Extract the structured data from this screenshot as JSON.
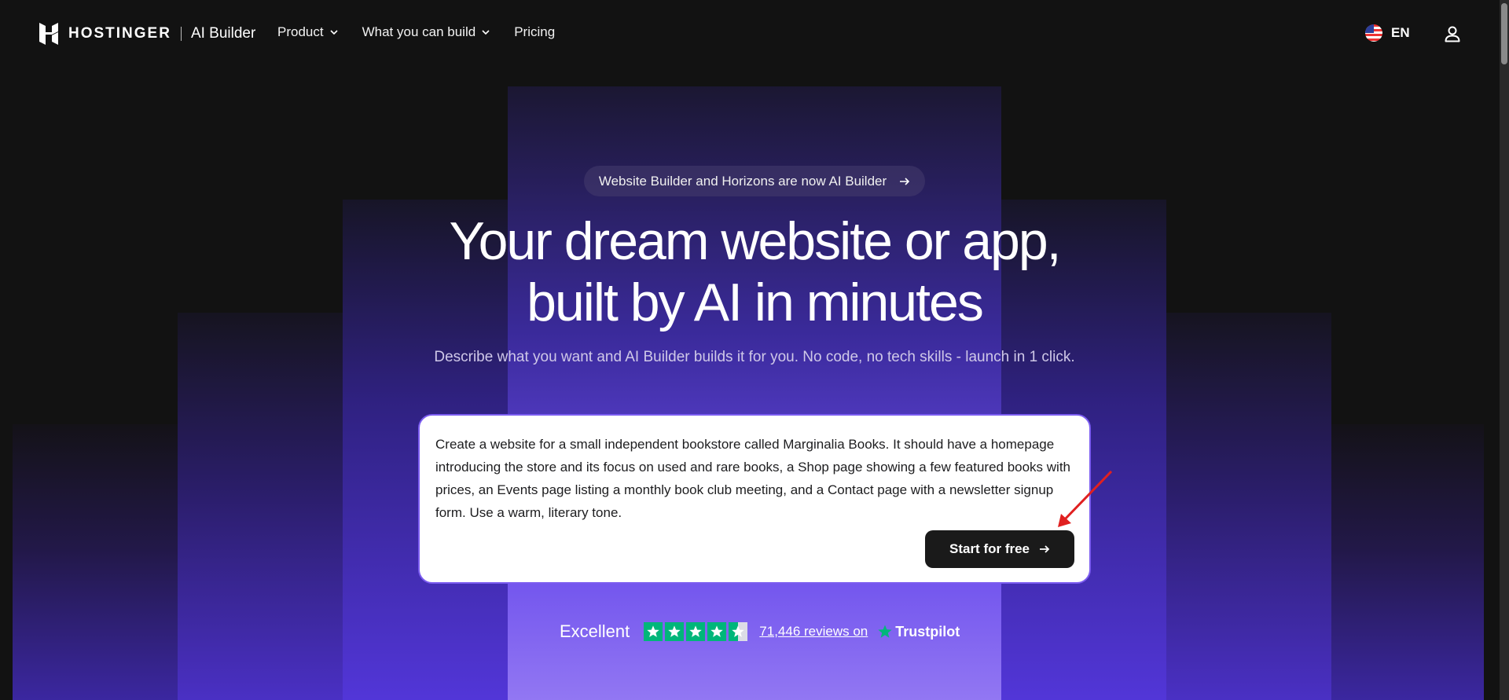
{
  "header": {
    "logo_word": "HOSTINGER",
    "logo_product": "AI Builder",
    "nav": [
      {
        "label": "Product",
        "has_dropdown": true
      },
      {
        "label": "What you can build",
        "has_dropdown": true
      },
      {
        "label": "Pricing",
        "has_dropdown": false
      }
    ],
    "language": "EN",
    "icons": {
      "flag": "us-flag-icon",
      "user": "user-icon"
    }
  },
  "hero": {
    "badge_text": "Website Builder and Horizons are now AI Builder",
    "headline_line1": "Your dream website or app,",
    "headline_line2": "built by AI in minutes",
    "subline": "Describe what you want and AI Builder builds it for you. No code, no tech skills - launch in 1 click."
  },
  "prompt": {
    "value": "Create a website for a small independent bookstore called Marginalia Books. It should have a homepage introducing the store and its focus on used and rare books, a Shop page showing a few featured books with prices, an Events page listing a monthly book club meeting, and a Contact page with a newsletter signup form. Use a warm, literary tone.",
    "button_label": "Start for free"
  },
  "trust": {
    "rating_word": "Excellent",
    "rating_stars": 4.5,
    "reviews_link": "71,446 reviews on",
    "provider": "Trustpilot"
  },
  "colors": {
    "background": "#121212",
    "accent": "#7b5cf0",
    "trustpilot_green": "#00b67a",
    "button": "#1a1a1a",
    "annotation": "#e02020"
  }
}
